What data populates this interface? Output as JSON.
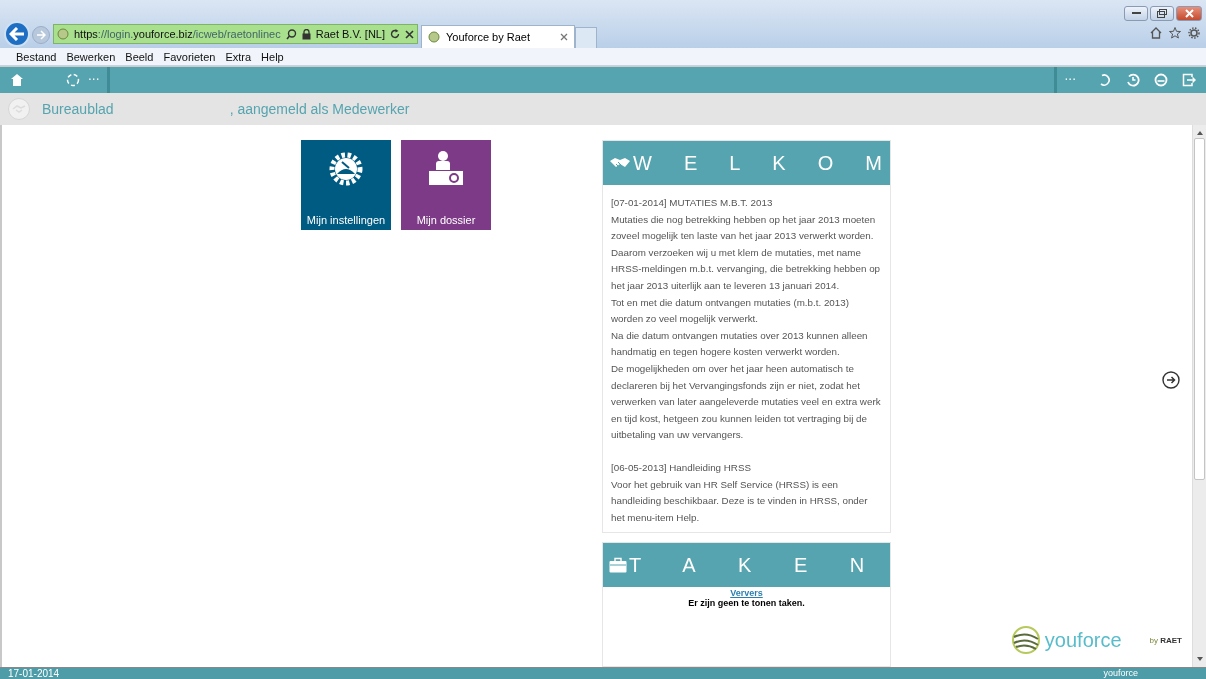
{
  "browser": {
    "url_host": "https://login.",
    "url_domain": "youforce.biz",
    "url_path": "/icweb/raetonlinec",
    "certificate": "Raet B.V. [NL]",
    "tabs": [
      {
        "title": "Youforce by Raet",
        "selected": true
      }
    ]
  },
  "menu": [
    "Bestand",
    "Bewerken",
    "Beeld",
    "Favorieten",
    "Extra",
    "Help"
  ],
  "toolbar": {
    "left_more": "···",
    "right_more": "···"
  },
  "breadcrumb": {
    "location": "Bureaublad",
    "user_suffix": ", aangemeld als Medewerker"
  },
  "tiles": [
    {
      "label": "Mijn instellingen",
      "kind": "settings",
      "color": "#005b82"
    },
    {
      "label": "Mijn dossier",
      "kind": "dossier",
      "color": "#7d3a87"
    }
  ],
  "welcome": {
    "title": "WELKOM",
    "items": [
      {
        "heading": "[07-01-2014] MUTATIES M.B.T. 2013",
        "paragraphs": [
          "Mutaties die nog betrekking hebben op het jaar 2013 moeten zoveel mogelijk ten laste van het jaar 2013 verwerkt worden.",
          "Daarom verzoeken wij u met klem de mutaties, met name HRSS-meldingen m.b.t. vervanging, die betrekking hebben op het jaar 2013 uiterlijk aan te leveren 13 januari 2014.",
          "Tot en met die datum ontvangen mutaties (m.b.t. 2013) worden zo veel mogelijk verwerkt.",
          "Na die datum ontvangen mutaties over 2013 kunnen alleen handmatig en tegen hogere kosten verwerkt worden.",
          "De mogelijkheden om over het jaar heen automatisch te declareren bij het Vervangingsfonds zijn er niet, zodat het verwerken van later aangeleverde mutaties veel en extra werk en tijd kost, hetgeen zou kunnen leiden tot vertraging bij de uitbetaling van uw vervangers."
        ]
      },
      {
        "heading": "[06-05-2013] Handleiding HRSS",
        "paragraphs": [
          "Voor het gebruik van HR Self Service (HRSS) is een handleiding beschikbaar. Deze is te vinden in HRSS, onder het menu-item Help."
        ]
      }
    ]
  },
  "tasks": {
    "title": "TAKEN",
    "refresh_link": "Ververs",
    "empty_message": "Er zijn geen te tonen taken."
  },
  "logo": {
    "name": "youforce",
    "by": "by",
    "brand": "RAET"
  },
  "status_bar": {
    "date": "17-01-2014",
    "logo": "youforce"
  }
}
